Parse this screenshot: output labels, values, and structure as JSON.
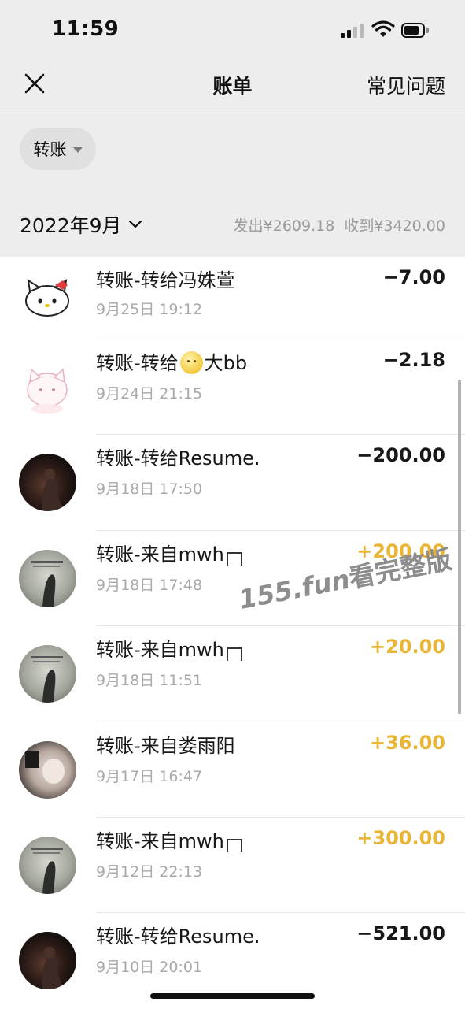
{
  "status": {
    "time": "11:59"
  },
  "nav": {
    "title": "账单",
    "faq": "常见问题"
  },
  "filter": {
    "label": "转账"
  },
  "month": {
    "label": "2022年9月",
    "out": "发出¥2609.18",
    "in": "收到¥3420.00"
  },
  "colors": {
    "background": "#ededed",
    "positive_amount": "#e9b534",
    "negative_amount": "#181818"
  },
  "transactions": [
    {
      "title": "转账-转给冯姝萱",
      "date": "9月25日 19:12",
      "amount": "−7.00",
      "direction": "out",
      "avatar": "hello-kitty-icon"
    },
    {
      "title_prefix": "转账-转给",
      "title_suffix": "大bb",
      "emoji": "smiling-moon-face-icon",
      "date": "9月24日 21:15",
      "amount": "−2.18",
      "direction": "out",
      "avatar": "cartoon-cat-icon"
    },
    {
      "title": "转账-转给Resume.",
      "date": "9月18日 17:50",
      "amount": "−200.00",
      "direction": "out",
      "avatar": "dark-portrait-avatar"
    },
    {
      "title": "转账-来自mwh",
      "date": "9月18日 17:48",
      "amount": "+200.00",
      "direction": "in",
      "avatar": "poster-avatar"
    },
    {
      "title": "转账-来自mwh",
      "date": "9月18日 11:51",
      "amount": "+20.00",
      "direction": "in",
      "avatar": "poster-avatar"
    },
    {
      "title": "转账-来自娄雨阳",
      "date": "9月17日 16:47",
      "amount": "+36.00",
      "direction": "in",
      "avatar": "photo-avatar"
    },
    {
      "title": "转账-来自mwh",
      "date": "9月12日 22:13",
      "amount": "+300.00",
      "direction": "in",
      "avatar": "poster-avatar"
    },
    {
      "title": "转账-转给Resume.",
      "date": "9月10日 20:01",
      "amount": "−521.00",
      "direction": "out",
      "avatar": "dark-portrait-avatar"
    }
  ],
  "watermark": {
    "site": "155.fun",
    "text": "看完整版"
  }
}
